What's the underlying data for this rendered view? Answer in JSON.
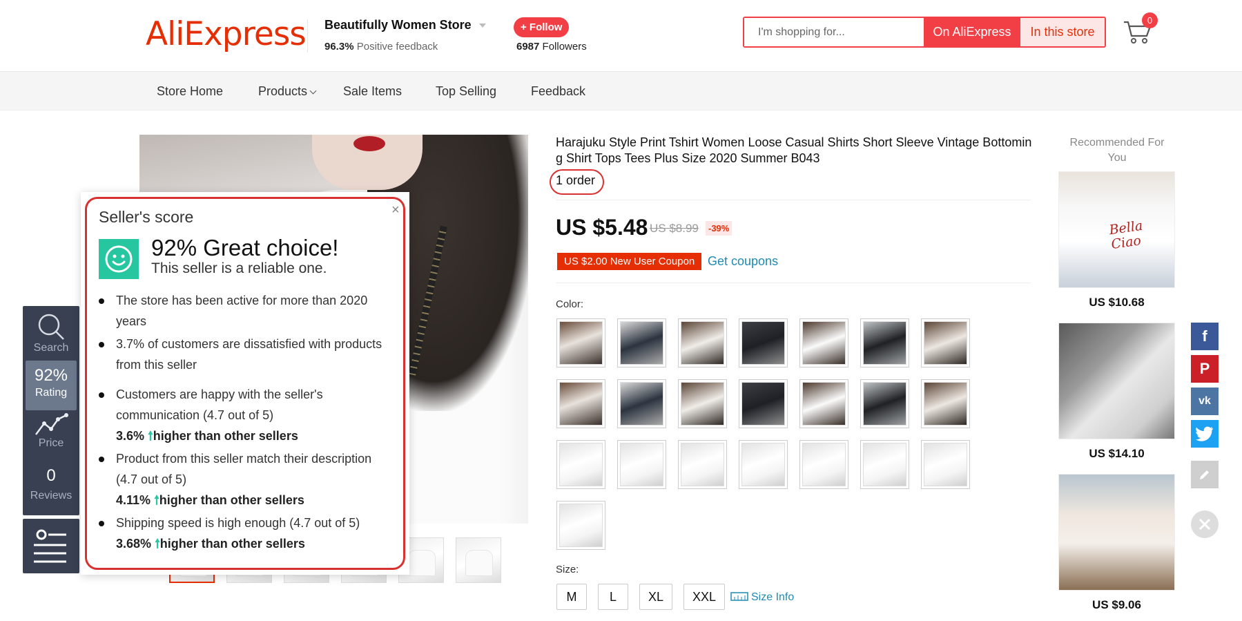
{
  "header": {
    "logo": "AliExpress",
    "store_name": "Beautifully Women Store",
    "feedback_pct": "96.3%",
    "feedback_label": "Positive feedback",
    "follow_label": "+ Follow",
    "followers_count": "6987",
    "followers_label": "Followers",
    "search_placeholder": "I'm shopping for...",
    "search_btn_ali": "On AliExpress",
    "search_btn_store": "In this store",
    "cart_count": "0"
  },
  "nav": {
    "items": [
      "Store Home",
      "Products",
      "Sale Items",
      "Top Selling",
      "Feedback"
    ]
  },
  "sidebar": {
    "search_label": "Search",
    "rating_value": "92%",
    "rating_label": "Rating",
    "price_label": "Price",
    "reviews_count": "0",
    "reviews_label": "Reviews"
  },
  "seller_score": {
    "title": "Seller's score",
    "close": "×",
    "headline": "92% Great choice!",
    "subline": "This seller is a reliable one.",
    "points": [
      {
        "text": "The store has been active for more than 2020 years"
      },
      {
        "text": "3.7% of customers are dissatisfied with products from this seller"
      },
      {
        "text": "Customers are happy with the seller's communication (4.7 out of 5)",
        "pct": "3.6%",
        "suffix": "higher than other sellers"
      },
      {
        "text": "Product from this seller match their description (4.7 out of 5)",
        "pct": "4.11%",
        "suffix": "higher than other sellers"
      },
      {
        "text": "Shipping speed is high enough (4.7 out of 5)",
        "pct": "3.68%",
        "suffix": "higher than other sellers"
      }
    ]
  },
  "product": {
    "title": "Harajuku Style Print Tshirt Women Loose Casual Shirts Short Sleeve Vintage Bottoming Shirt Tops Tees Plus Size 2020 Summer B043",
    "orders": "1 order",
    "price": "US $5.48",
    "old_price": "US $8.99",
    "discount": "-39%",
    "coupon": "US $2.00 New User Coupon",
    "get_coupons": "Get coupons",
    "color_label": "Color:",
    "size_label": "Size:",
    "sizes": [
      "M",
      "L",
      "XL",
      "XXL"
    ],
    "size_info": "Size Info"
  },
  "recommended": {
    "title": "Recommended For You",
    "items": [
      {
        "price": "US $10.68",
        "print": "Bella Ciao"
      },
      {
        "price": "US $14.10"
      },
      {
        "price": "US $9.06"
      }
    ]
  },
  "colors": {
    "brand": "#e62e04",
    "accent": "#f23e45",
    "link": "#1f8ab3",
    "up_green": "#26c6a0",
    "facebook": "#3b5998",
    "pinterest": "#cb2027",
    "vk": "#4c75a3",
    "twitter": "#1da1f2"
  }
}
